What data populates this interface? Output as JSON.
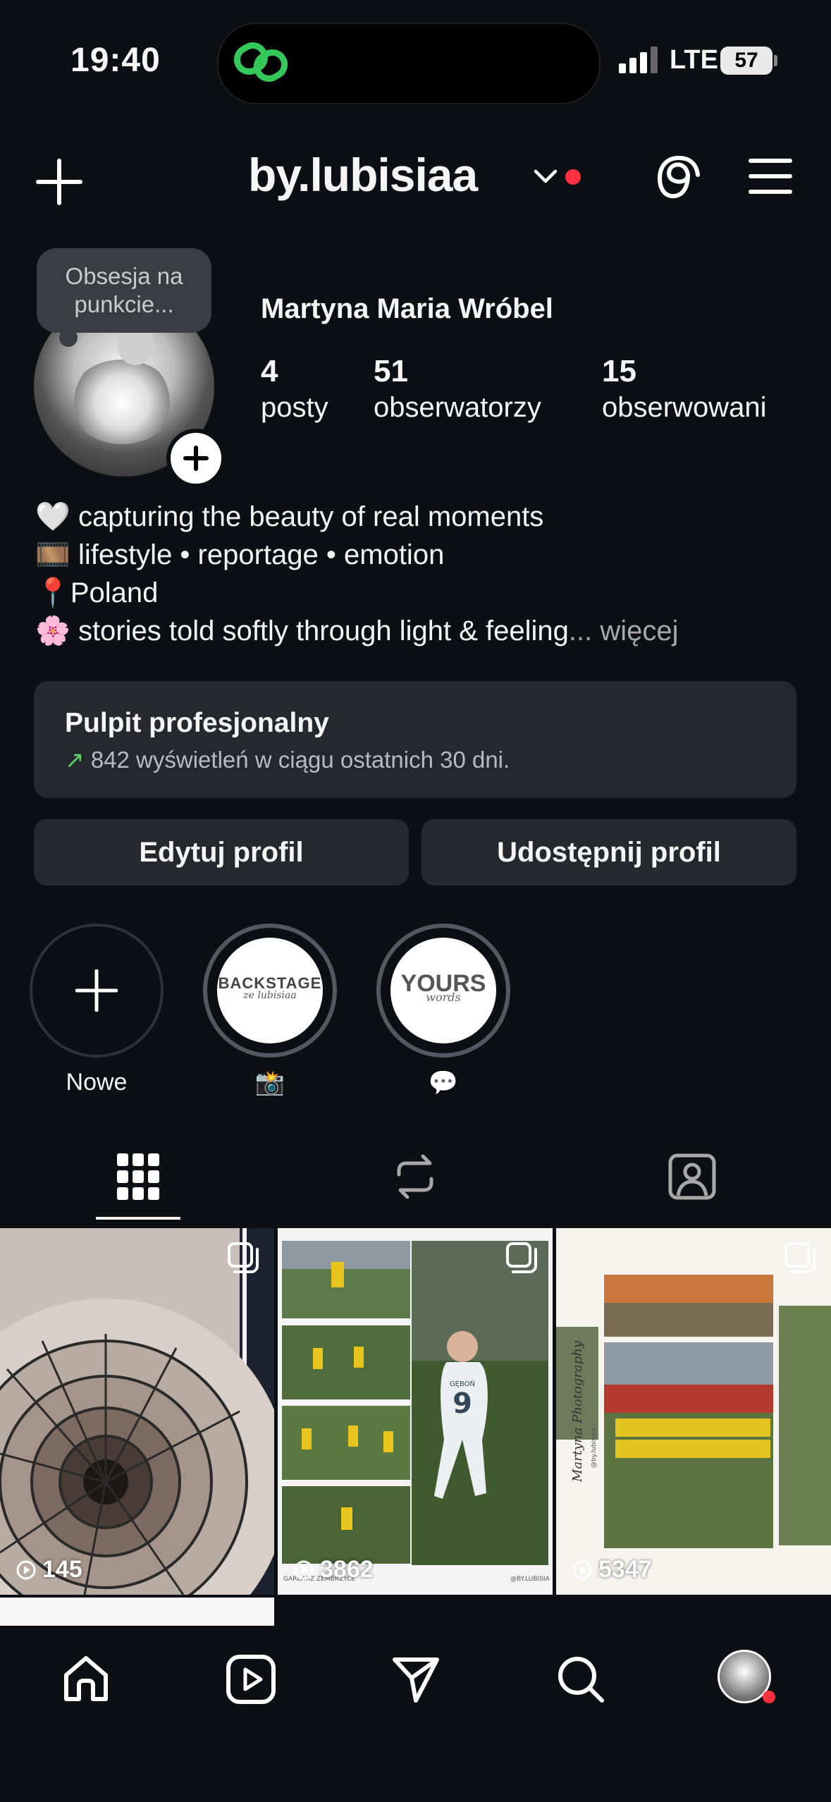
{
  "status": {
    "time": "19:40",
    "network": "LTE",
    "battery": "57"
  },
  "header": {
    "username": "by.lubisiaa"
  },
  "profile": {
    "note": "Obsesja na punkcie...",
    "full_name": "Martyna Maria Wróbel",
    "stats": [
      {
        "value": "4",
        "label": "posty"
      },
      {
        "value": "51",
        "label": "obserwatorzy"
      },
      {
        "value": "15",
        "label": "obserwowani"
      }
    ],
    "bio": [
      {
        "emoji": "🤍",
        "text": "capturing the beauty of real moments"
      },
      {
        "emoji": "🎞️",
        "text": "lifestyle • reportage • emotion"
      },
      {
        "emoji": "📍",
        "text": "Poland"
      },
      {
        "emoji": "🌸",
        "text": "stories told softly through light & feeling"
      }
    ],
    "bio_ellipsis": "...",
    "more": "więcej"
  },
  "dashboard": {
    "title": "Pulpit profesjonalny",
    "subtitle": "842 wyświetleń w ciągu ostatnich 30 dni."
  },
  "buttons": {
    "edit": "Edytuj profil",
    "share": "Udostępnij profil"
  },
  "highlights": [
    {
      "label": "Nowe",
      "cover_text": ""
    },
    {
      "label": "📸",
      "cover_text": "BACKSTAGE",
      "cover_sub": "ze lubisiaa"
    },
    {
      "label": "💬",
      "cover_text": "YOURS",
      "cover_sub": "words"
    }
  ],
  "tabs": [
    "grid-icon",
    "reels-repost-icon",
    "tagged-icon"
  ],
  "posts": [
    {
      "views": "145"
    },
    {
      "views": "3862",
      "caption_left": "GARBARZ ZEMBRZYCE",
      "caption_right": "@BY.LUBISIA",
      "jersey": "9",
      "jersey_name": "GĘBOŃ"
    },
    {
      "views": "5347",
      "watermark": "Martyna Photography",
      "watermark_handle": "@by.lubisiaa"
    }
  ],
  "nav": [
    "home-icon",
    "reels-icon",
    "messages-icon",
    "search-icon",
    "profile-avatar"
  ],
  "colors": {
    "background": "#0c1014",
    "card": "#25292e",
    "accent_red": "#ff3040",
    "accent_green": "#5fd068"
  }
}
